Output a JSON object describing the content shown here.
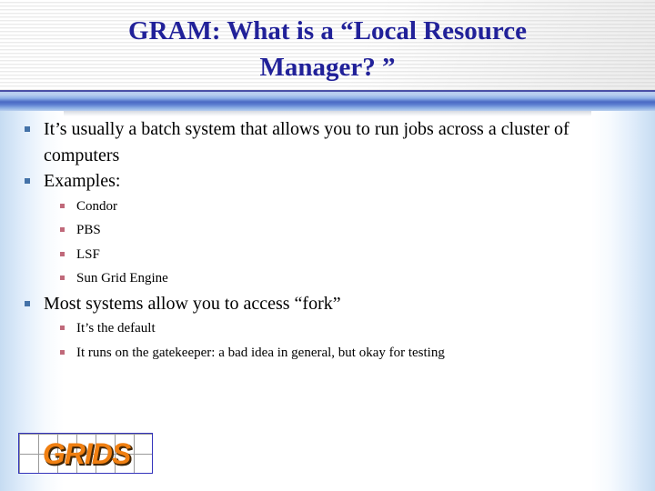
{
  "slide": {
    "title": "GRAM: What is a “Local Resource Manager? ”",
    "title_line1": "GRAM: What is a “Local Resource",
    "title_line2": "Manager? ”",
    "title_text": "GRAM: What is a “Local Resource\nManager? ”",
    "title_color": "#212199",
    "bullet_level1_color": "#4472a8",
    "bullet_level2_color": "#c0697a",
    "divider_color": "#4a69c4",
    "body_text_color": "#000000"
  },
  "bullets": [
    {
      "level": 1,
      "text": "It’s usually a batch system that allows you to run jobs across a cluster of computers"
    },
    {
      "level": 1,
      "text": "Examples:"
    },
    {
      "level": 2,
      "text": "Condor"
    },
    {
      "level": 2,
      "text": "PBS"
    },
    {
      "level": 2,
      "text": "LSF"
    },
    {
      "level": 2,
      "text": "Sun Grid Engine"
    },
    {
      "level": 1,
      "text": "Most systems allow you to access “fork”"
    },
    {
      "level": 2,
      "text": "It’s the default"
    },
    {
      "level": 2,
      "text": "It runs on the gatekeeper: a bad idea in general, but okay for testing"
    }
  ],
  "logo": {
    "text": "GRIDS",
    "text_color": "#f07f11",
    "border_color": "#3333bb",
    "grid_line_color": "#9a9a9a"
  }
}
